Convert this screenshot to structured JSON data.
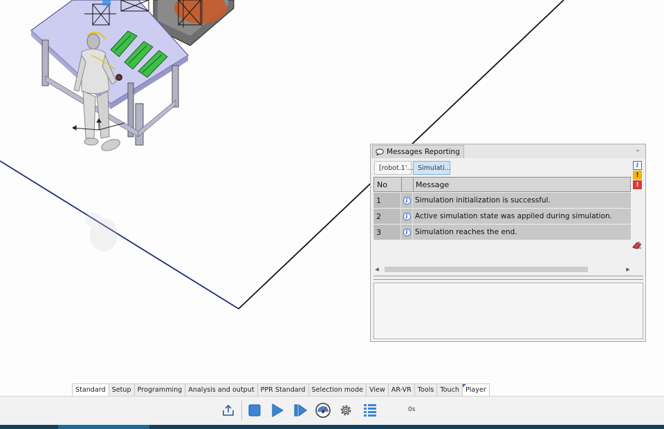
{
  "messages_panel": {
    "title": "Messages Reporting",
    "minimize_glyph": "–",
    "filter_tabs": [
      {
        "label": "[robot.1'..."
      },
      {
        "label": "Simulati..."
      }
    ],
    "columns": {
      "no": "No",
      "message": "Message"
    },
    "rows": [
      {
        "no": "1",
        "icon": "info-icon",
        "message": "Simulation initialization is successful."
      },
      {
        "no": "2",
        "icon": "info-icon",
        "message": "Active simulation state was applied during simulation."
      },
      {
        "no": "3",
        "icon": "info-icon",
        "message": "Simulation reaches the end."
      }
    ],
    "side_icons": {
      "info": "i",
      "warning": "!",
      "error": "!"
    }
  },
  "workbench_tabs": [
    {
      "label": "Standard",
      "active": true
    },
    {
      "label": "Setup"
    },
    {
      "label": "Programming"
    },
    {
      "label": "Analysis and output"
    },
    {
      "label": "PPR Standard"
    },
    {
      "label": "Selection mode"
    },
    {
      "label": "View"
    },
    {
      "label": "AR-VR"
    },
    {
      "label": "Tools"
    },
    {
      "label": "Touch"
    },
    {
      "label": "Player",
      "marked": true
    }
  ],
  "player_toolbar": {
    "time": "0s",
    "icons": [
      "export-icon",
      "stop-icon",
      "play-icon",
      "step-forward-icon",
      "speed-gauge-icon",
      "settings-gear-icon",
      "list-icon"
    ]
  },
  "colors": {
    "table_green": "#3fbf48",
    "table_top": "#c8c8ee",
    "accent_blue": "#2f6fbf",
    "status_bar": "#123f5c"
  }
}
